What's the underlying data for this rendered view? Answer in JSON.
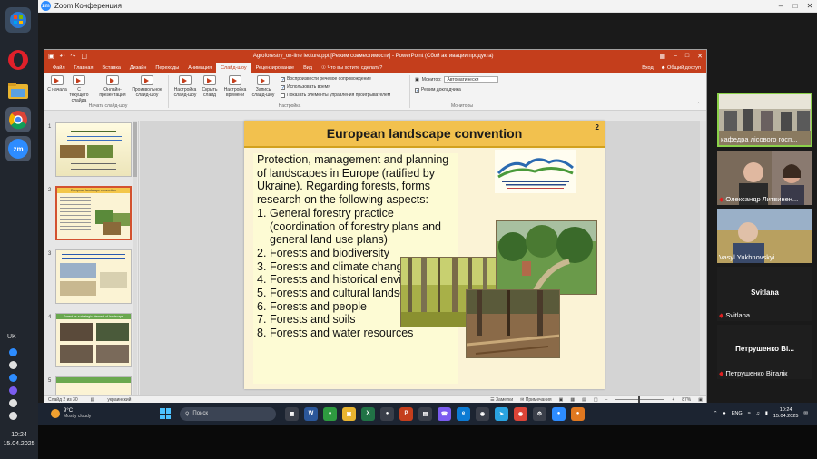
{
  "zoom": {
    "title": "Zoom Конференция",
    "logo": "zm"
  },
  "dock": {
    "items": [
      {
        "icon": "opera-icon",
        "color": "#e0202a"
      },
      {
        "icon": "folder-icon",
        "color": "#e8b430"
      },
      {
        "icon": "chrome-icon",
        "color": "#3b9c4e"
      },
      {
        "icon": "zoom-icon",
        "color": "#2d8cff",
        "label": "zm"
      }
    ],
    "lang": "UK",
    "time": "10:24",
    "date": "15.04.2025"
  },
  "ppt": {
    "title": "Agroforestry_on-line lecture.ppt [Режим совместимости] - PowerPoint (Сбой активации продукта)",
    "tabs": [
      "Файл",
      "Главная",
      "Вставка",
      "Дизайн",
      "Переходы",
      "Анимация",
      "Слайд-шоу",
      "Рецензирование",
      "Вид"
    ],
    "active_tab": "Слайд-шоу",
    "search": "Что вы хотите сделать?",
    "signin": "Вход",
    "share": "Общий доступ",
    "ribbon": {
      "buttons": [
        "С начала",
        "С текущего слайда",
        "Онлайн-презентация",
        "Произвольное слайд-шоу",
        "Настройка слайд-шоу",
        "Скрыть слайд",
        "Настройка времени",
        "Запись слайд-шоу"
      ],
      "checks": [
        {
          "label": "Воспроизвести речевое сопровождение",
          "checked": true
        },
        {
          "label": "Использовать время",
          "checked": true
        },
        {
          "label": "Показать элементы управления проигрывателем",
          "checked": false
        }
      ],
      "monitor_label": "Монитор:",
      "monitor_value": "Автоматически",
      "presenter_view": "Режим докладчика",
      "group_start": "Начать слайд-шоу",
      "group_setup": "Настройка",
      "group_monitors": "Мониторы"
    },
    "thumbnails": [
      {
        "num": "1",
        "title": ""
      },
      {
        "num": "2",
        "title": "European landscape convention"
      },
      {
        "num": "3",
        "title": ""
      },
      {
        "num": "4",
        "title": "Forest as a strategic element of landscape"
      },
      {
        "num": "5",
        "title": ""
      }
    ],
    "slide": {
      "number": "2",
      "title": "European landscape convention",
      "intro": "Protection, management and planning of landscapes in Europe (ratified by Ukraine). Regarding forests, forms research on the following aspects:",
      "items": [
        {
          "n": "1.",
          "text": "General forestry practice (coordination of forestry plans and general land use plans)"
        },
        {
          "n": "2.",
          "text": "Forests and biodiversity"
        },
        {
          "n": "3.",
          "text": "Forests and climate change"
        },
        {
          "n": "4.",
          "text": "Forests and historical environment"
        },
        {
          "n": "5.",
          "text": "Forests and cultural landscape"
        },
        {
          "n": "6.",
          "text": "Forests and people"
        },
        {
          "n": "7.",
          "text": "Forests and soils"
        },
        {
          "n": "8.",
          "text": "Forests and water resources"
        }
      ]
    },
    "status": {
      "slide_of": "Слайд 2 из 30",
      "lang": "украинский",
      "notes": "Заметки",
      "comments": "Примечания",
      "zoom": "87%"
    }
  },
  "participants": [
    {
      "name": "кафедра лісового госп...",
      "muted": false,
      "active": true,
      "video": true
    },
    {
      "name": "Олександр Литвинен...",
      "muted": true,
      "active": false,
      "video": true
    },
    {
      "name": "Vasyl Yukhnovskyi",
      "muted": false,
      "active": false,
      "video": true
    },
    {
      "name": "Svitlana",
      "big_name": "Svitlana",
      "muted": true,
      "active": false,
      "video": false
    },
    {
      "name": "Петрушенко Віталік",
      "big_name": "Петрушенко Ві...",
      "muted": true,
      "active": false,
      "video": false
    }
  ],
  "taskbar": {
    "weather_temp": "9°C",
    "weather_desc": "Mostly cloudy",
    "search": "Поиск",
    "lang": "ENG",
    "time": "10:24",
    "date": "15.04.2025"
  }
}
